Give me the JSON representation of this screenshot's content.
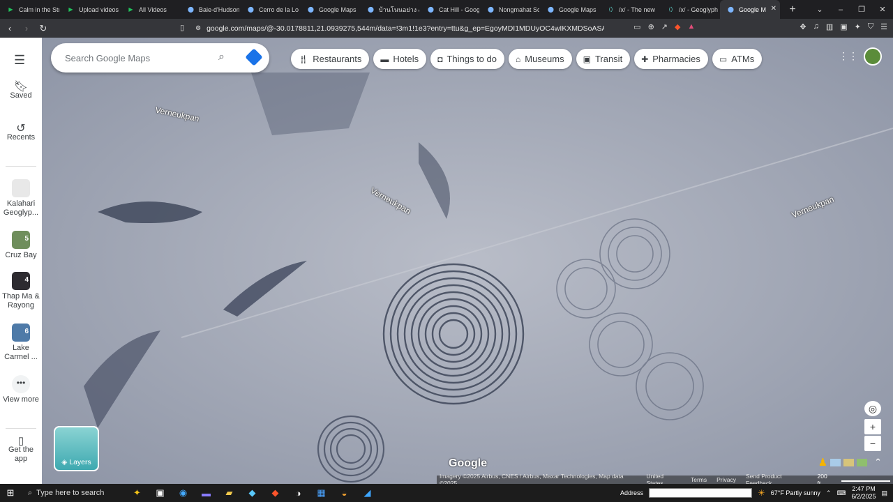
{
  "browser": {
    "tabs": [
      {
        "title": "Calm in the Str",
        "icon": "play-icon",
        "color": "#21c35d"
      },
      {
        "title": "Upload videos",
        "icon": "play-icon",
        "color": "#21c35d"
      },
      {
        "title": "All Videos",
        "icon": "play-icon",
        "color": "#21c35d"
      },
      {
        "title": "Baie-d'Hudson",
        "icon": "map-pin-icon",
        "color": "#7db6ff"
      },
      {
        "title": "Cerro de la Lo",
        "icon": "map-pin-icon",
        "color": "#7db6ff"
      },
      {
        "title": "Google Maps",
        "icon": "map-pin-icon",
        "color": "#7db6ff"
      },
      {
        "title": "บ้านโนนอย่าง & น",
        "icon": "map-pin-icon",
        "color": "#7db6ff"
      },
      {
        "title": "Cat Hill - Goog",
        "icon": "map-pin-icon",
        "color": "#7db6ff"
      },
      {
        "title": "Nongmahat So",
        "icon": "map-pin-icon",
        "color": "#7db6ff"
      },
      {
        "title": "Google Maps",
        "icon": "map-pin-icon",
        "color": "#7db6ff"
      },
      {
        "title": "/x/ - The new",
        "icon": "code-icon",
        "color": "#5fd1c8"
      },
      {
        "title": "/x/ - Geoglyph",
        "icon": "code-icon",
        "color": "#5fd1c8"
      },
      {
        "title": "Google M",
        "icon": "map-pin-icon",
        "color": "#7db6ff",
        "active": true
      }
    ],
    "url": "google.com/maps/@-30.0178811,21.0939275,544m/data=!3m1!1e3?entry=ttu&g_ep=EgoyMDI1MDUyOC4wIKXMDSoASAFQAw%3D%3D"
  },
  "rail": {
    "items": [
      {
        "label": "Saved",
        "icon": "bookmark-icon"
      },
      {
        "label": "Recents",
        "icon": "history-icon"
      },
      {
        "label": "Kalahari Geoglyp...",
        "icon": "place-thumbnail"
      },
      {
        "label": "Cruz Bay",
        "badge": "5",
        "icon": "place-thumbnail"
      },
      {
        "label": "Thap Ma & Rayong",
        "badge": "4",
        "icon": "place-thumbnail"
      },
      {
        "label": "Lake Carmel ...",
        "badge": "6",
        "icon": "place-thumbnail"
      },
      {
        "label": "View more",
        "icon": "more-icon"
      },
      {
        "label": "Get the app",
        "icon": "phone-icon"
      }
    ]
  },
  "search": {
    "placeholder": "Search Google Maps"
  },
  "chips": [
    {
      "label": "Restaurants",
      "icon": "fork-knife-icon"
    },
    {
      "label": "Hotels",
      "icon": "bed-icon"
    },
    {
      "label": "Things to do",
      "icon": "camera-icon"
    },
    {
      "label": "Museums",
      "icon": "museum-icon"
    },
    {
      "label": "Transit",
      "icon": "bus-icon"
    },
    {
      "label": "Pharmacies",
      "icon": "pharmacy-icon"
    },
    {
      "label": "ATMs",
      "icon": "atm-icon"
    }
  ],
  "map": {
    "labels": [
      "Verneukpan",
      "Verneukpan",
      "Verneukpan"
    ],
    "logo": "Google",
    "layers_label": "Layers",
    "attribution": "Imagery ©2025 Airbus, CNES / Airbus, Maxar Technologies, Map data ©2025",
    "links": [
      "United States",
      "Terms",
      "Privacy",
      "Send Product Feedback"
    ],
    "scale": "200 ft"
  },
  "taskbar": {
    "search_placeholder": "Type here to search",
    "address_label": "Address",
    "weather": "67°F  Partly sunny",
    "time": "2:47 PM",
    "date": "6/2/2025"
  }
}
